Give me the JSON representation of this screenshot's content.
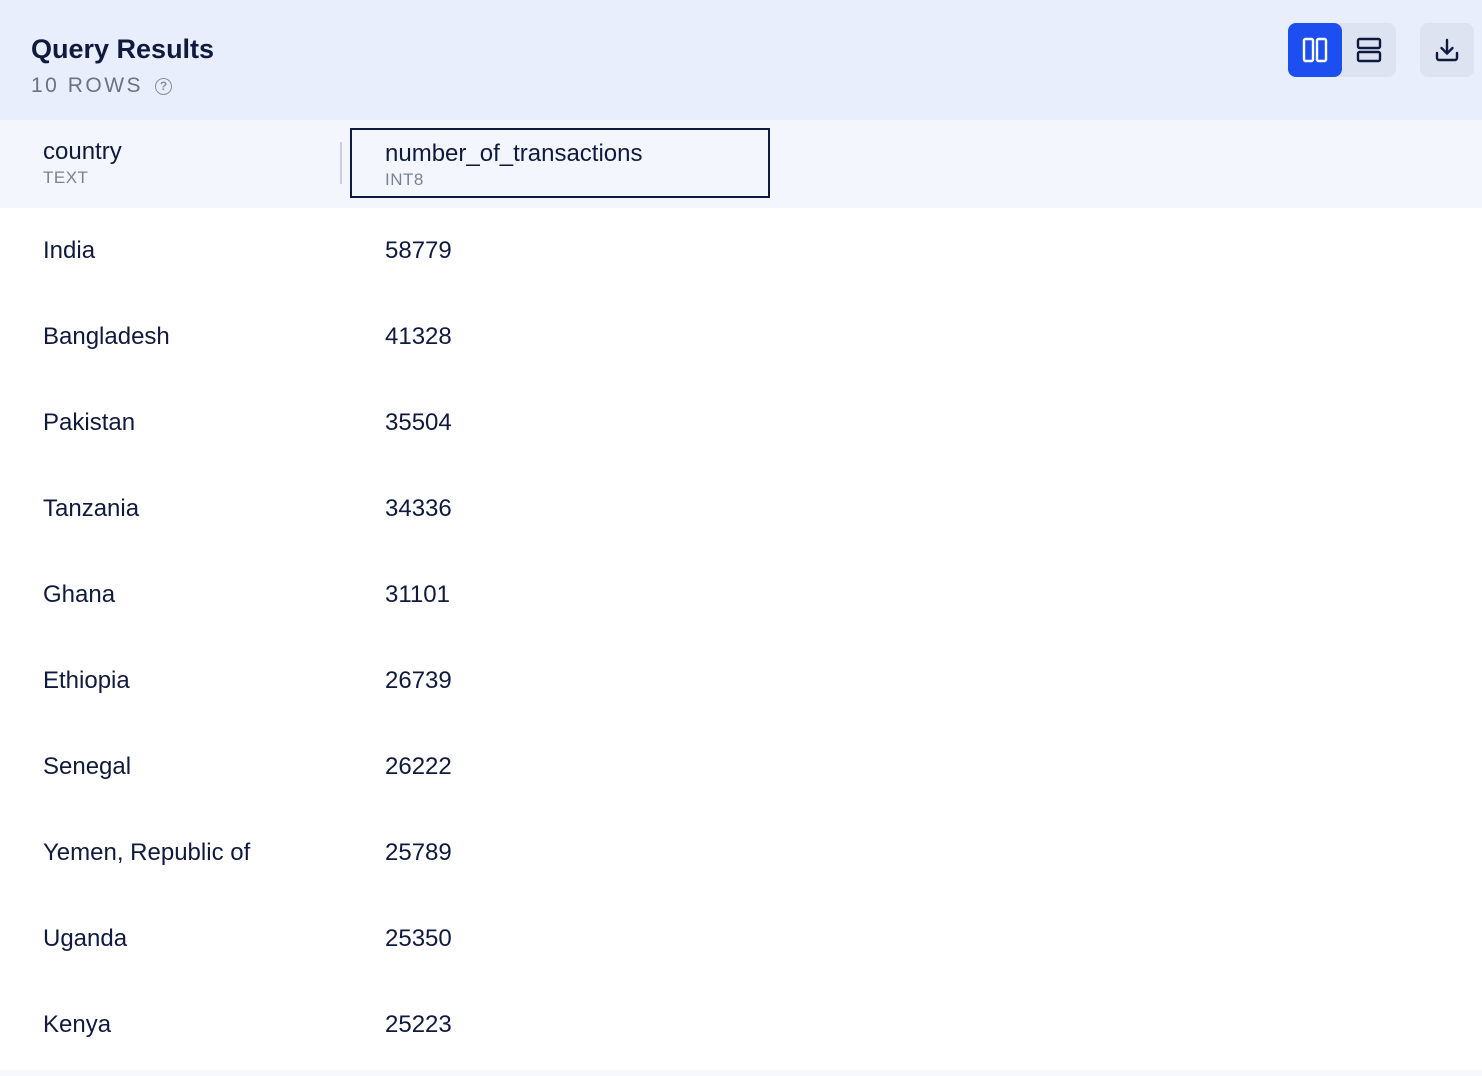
{
  "header": {
    "title": "Query Results",
    "row_count": "10 ROWS",
    "help_icon": "?"
  },
  "toolbar": {
    "columns_view_icon": "columns-icon",
    "rows_view_icon": "rows-icon",
    "download_icon": "download-icon",
    "active_view": "columns"
  },
  "colors": {
    "header_bg": "#e8eefc",
    "accent": "#1d4ff0",
    "text": "#0f1a3d"
  },
  "table": {
    "columns": [
      {
        "name": "country",
        "type": "TEXT"
      },
      {
        "name": "number_of_transactions",
        "type": "INT8"
      }
    ],
    "rows": [
      [
        "India",
        "58779"
      ],
      [
        "Bangladesh",
        "41328"
      ],
      [
        "Pakistan",
        "35504"
      ],
      [
        "Tanzania",
        "34336"
      ],
      [
        "Ghana",
        "31101"
      ],
      [
        "Ethiopia",
        "26739"
      ],
      [
        "Senegal",
        "26222"
      ],
      [
        "Yemen, Republic of",
        "25789"
      ],
      [
        "Uganda",
        "25350"
      ],
      [
        "Kenya",
        "25223"
      ]
    ]
  }
}
